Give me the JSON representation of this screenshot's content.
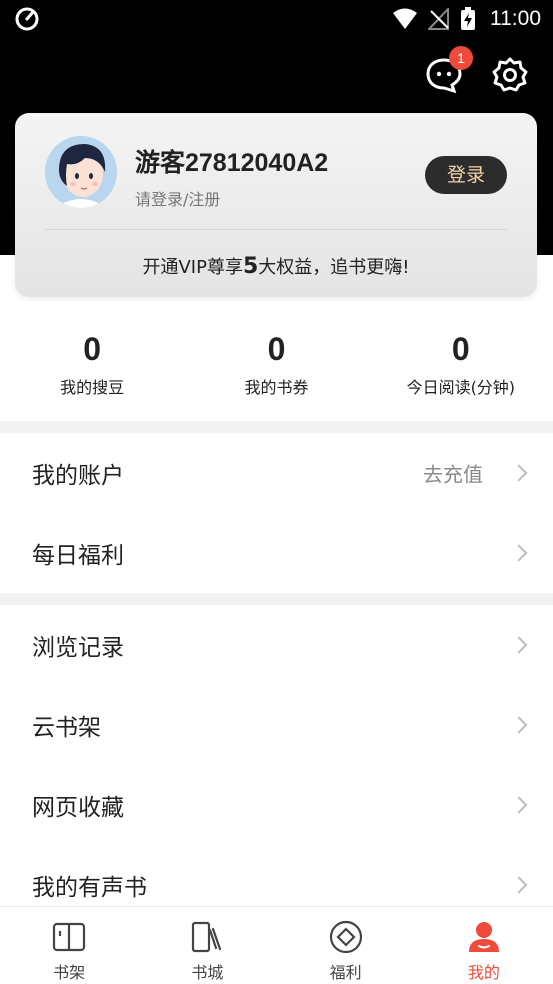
{
  "status_bar": {
    "time": "11:00"
  },
  "header": {
    "message_badge": "1",
    "icons": [
      "message-icon",
      "settings-icon"
    ]
  },
  "profile": {
    "username": "游客27812040A2",
    "login_hint": "请登录/注册",
    "login_button": "登录",
    "vip_prefix": "开通VIP尊享",
    "vip_number": "5",
    "vip_suffix": "大权益，追书更嗨!"
  },
  "stats": [
    {
      "value": "0",
      "label": "我的搜豆"
    },
    {
      "value": "0",
      "label": "我的书券"
    },
    {
      "value": "0",
      "label": "今日阅读(分钟)"
    }
  ],
  "menu": {
    "group1": [
      {
        "label": "我的账户",
        "extra": "去充值"
      },
      {
        "label": "每日福利"
      }
    ],
    "group2": [
      {
        "label": "浏览记录"
      },
      {
        "label": "云书架"
      },
      {
        "label": "网页收藏"
      },
      {
        "label": "我的有声书"
      }
    ]
  },
  "bottom_nav": [
    {
      "label": "书架",
      "icon": "bookshelf-icon"
    },
    {
      "label": "书城",
      "icon": "bookstore-icon"
    },
    {
      "label": "福利",
      "icon": "welfare-icon"
    },
    {
      "label": "我的",
      "icon": "profile-icon",
      "active": true
    }
  ],
  "colors": {
    "accent": "#ef4a3a",
    "login_text": "#f3d4a6",
    "header_bg": "#000000"
  }
}
